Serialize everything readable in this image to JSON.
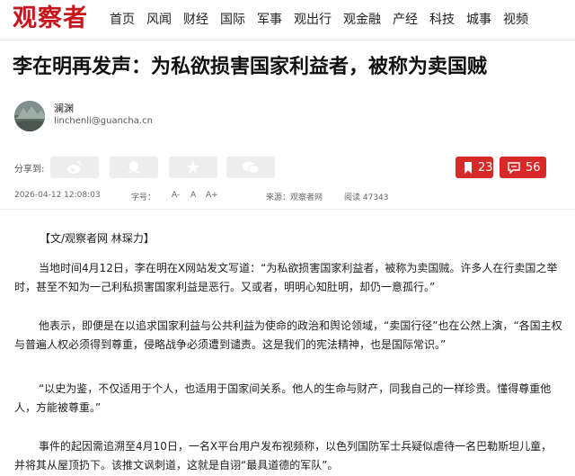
{
  "header": {
    "logo": "观察者",
    "nav": [
      "首页",
      "风闻",
      "财经",
      "国际",
      "军事",
      "观出行",
      "观金融",
      "产经",
      "科技",
      "城事",
      "视频"
    ]
  },
  "article": {
    "title": "李在明再发声：为私欲损害国家利益者，被称为卖国贼",
    "author": {
      "name": "澜渊",
      "email": "linchenli@guancha.cn"
    },
    "share": {
      "label": "分享到:",
      "icons": [
        "weibo-icon",
        "qq-icon",
        "qzone-star-icon",
        "wechat-icon"
      ]
    },
    "counts": {
      "bookmarks": "23",
      "comments": "56"
    },
    "meta": {
      "date": "2026-04-12 12:08:03",
      "font_label": "字号：",
      "font_options": [
        "A-",
        "A",
        "A+"
      ],
      "source": "来源：观察者网",
      "reads": "阅读 47343"
    },
    "source_line": "【文/观察者网 林琛力】",
    "paragraphs": [
      "当地时间4月12日，李在明在X网站发文写道：“为私欲损害国家利益者，被称为卖国贼。许多人在行卖国之举时，甚至不知为一己利私损害国家利益是恶行。又或者，明明心知肚明，却仍一意孤行。”",
      "他表示，即便是在以追求国家利益与公共利益为使命的政治和舆论领域，“卖国行径”也在公然上演，“各国主权与普遍人权必须得到尊重，侵略战争必须遭到谴责。这是我们的宪法精神，也是国际常识。”",
      "“以史为鉴，不仅适用于个人，也适用于国家间关系。他人的生命与财产，同我自己的一样珍贵。懂得尊重他人，方能被尊重。”",
      "事件的起因需追溯至4月10日，一名X平台用户发布视频称，以色列国防军士兵疑似虐待一名巴勒斯坦儿童，并将其从屋顶扔下。该推文讽刺道，这就是自诩“最具道德的军队”。"
    ]
  },
  "colors": {
    "brand_red": "#c8161d",
    "button_red": "#d72a28",
    "share_gray": "#ededed"
  }
}
